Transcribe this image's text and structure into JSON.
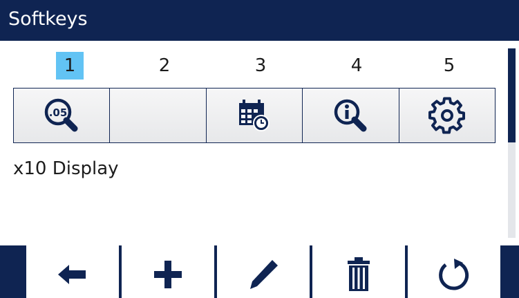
{
  "header": {
    "title": "Softkeys"
  },
  "softkeys": {
    "numbers": [
      "1",
      "2",
      "3",
      "4",
      "5"
    ],
    "selected_index": 1,
    "keys": [
      {
        "icon": "x10-display-icon",
        "icon_text": ".05"
      },
      {
        "icon": ""
      },
      {
        "icon": "calendar-clock-icon"
      },
      {
        "icon": "info-search-icon"
      },
      {
        "icon": "gear-icon"
      }
    ],
    "selected_description": "x10 Display"
  },
  "bottom_bar": {
    "keys": [
      {
        "icon": "arrow-left-icon"
      },
      {
        "icon": "plus-icon"
      },
      {
        "icon": "pencil-icon"
      },
      {
        "icon": "trash-icon"
      },
      {
        "icon": "refresh-icon"
      }
    ]
  },
  "colors": {
    "title_bar": "#0f2452",
    "selection": "#62c3f4",
    "icon": "#0f2452"
  }
}
